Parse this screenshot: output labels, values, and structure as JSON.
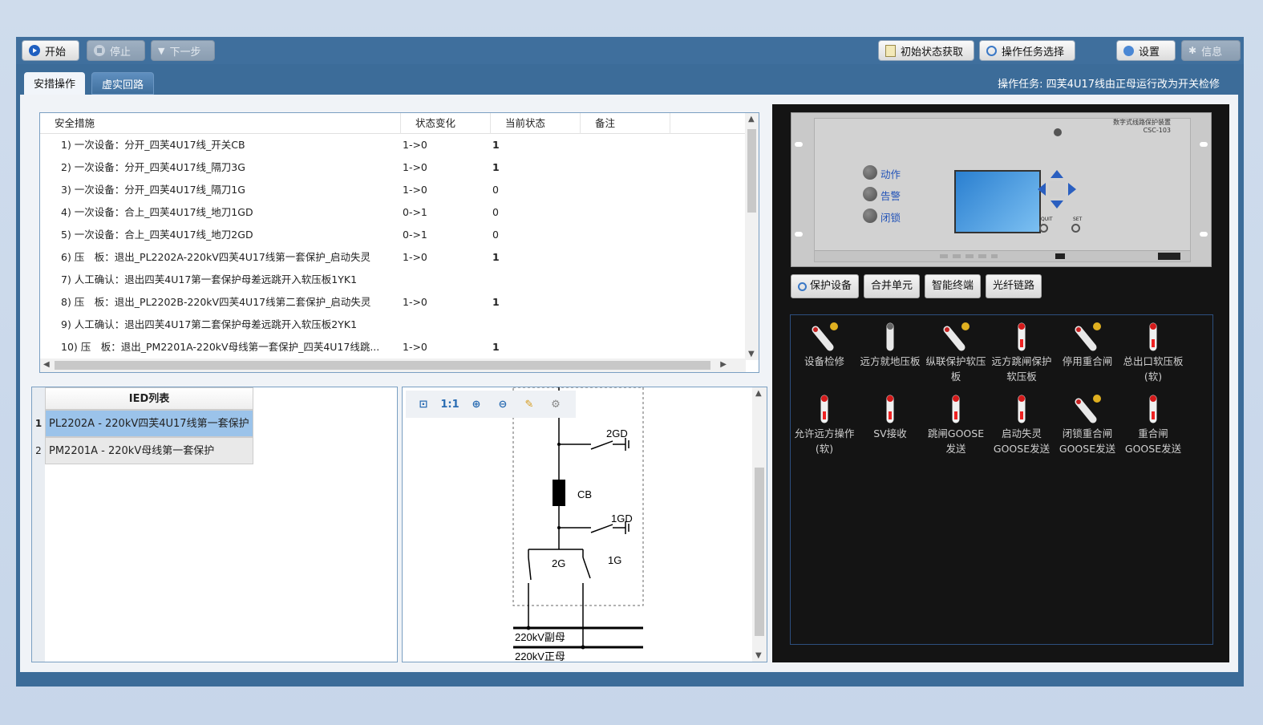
{
  "toolbar": {
    "start_label": "开始",
    "stop_label": "停止",
    "next_label": "下一步",
    "init_state_label": "初始状态获取",
    "task_select_label": "操作任务选择",
    "settings_label": "设置",
    "info_label": "信息"
  },
  "tabs": [
    "安措操作",
    "虚实回路"
  ],
  "task_text": "操作任务: 四芙4U17线由正母运行改为开关检修",
  "steps_table": {
    "headers": [
      "安全措施",
      "状态变化",
      "当前状态",
      "备注"
    ],
    "rows": [
      {
        "measure": "1) 一次设备：分开_四芙4U17线_开关CB",
        "change": "1->0",
        "current": "1"
      },
      {
        "measure": "2) 一次设备：分开_四芙4U17线_隔刀3G",
        "change": "1->0",
        "current": "1"
      },
      {
        "measure": "3) 一次设备：分开_四芙4U17线_隔刀1G",
        "change": "1->0",
        "current": "0"
      },
      {
        "measure": "4) 一次设备：合上_四芙4U17线_地刀1GD",
        "change": "0->1",
        "current": "0"
      },
      {
        "measure": "5) 一次设备：合上_四芙4U17线_地刀2GD",
        "change": "0->1",
        "current": "0"
      },
      {
        "measure": "6) 压　板：退出_PL2202A-220kV四芙4U17线第一套保护_启动失灵",
        "change": "1->0",
        "current": "1"
      },
      {
        "measure": "7) 人工确认：退出四芙4U17第一套保护母差远跳开入软压板1YK1",
        "change": "",
        "current": ""
      },
      {
        "measure": "8) 压　板：退出_PL2202B-220kV四芙4U17线第二套保护_启动失灵",
        "change": "1->0",
        "current": "1"
      },
      {
        "measure": "9) 人工确认：退出四芙4U17第二套保护母差远跳开入软压板2YK1",
        "change": "",
        "current": ""
      },
      {
        "measure": "10) 压　板：退出_PM2201A-220kV母线第一套保护_四芙4U17线跳...",
        "change": "1->0",
        "current": "1"
      }
    ]
  },
  "ied_list": {
    "header": "IED列表",
    "rows": [
      {
        "num": "1",
        "name": "PL2202A - 220kV四芙4U17线第一套保护"
      },
      {
        "num": "2",
        "name": "PM2201A - 220kV母线第一套保护"
      }
    ]
  },
  "diagram": {
    "tools": [
      "zoom-fit-icon",
      "actual-size-icon",
      "zoom-in-icon",
      "zoom-out-icon",
      "brush-icon",
      "gear-icon"
    ],
    "actual_size_label": "1:1",
    "labels": {
      "gd2": "2GD",
      "cb": "CB",
      "gd1": "1GD",
      "g2": "2G",
      "g1": "1G",
      "bus2": "220kV副母",
      "bus1": "220kV正母"
    }
  },
  "relay": {
    "title": "数字式线路保护装置",
    "model": "CSC-103",
    "leds": [
      "动作",
      "告警",
      "闭锁"
    ],
    "quit_label": "QUIT",
    "set_label": "SET"
  },
  "device_tabs": [
    "保护设备",
    "合并单元",
    "智能终端",
    "光纤链路"
  ],
  "plates": [
    {
      "label": "设备检修",
      "state": "tilted"
    },
    {
      "label": "远方就地压板",
      "state": "off-grey"
    },
    {
      "label": "纵联保护软压板",
      "state": "tilted"
    },
    {
      "label": "远方跳闸保护软压板",
      "state": "on-red"
    },
    {
      "label": "停用重合闸",
      "state": "tilted"
    },
    {
      "label": "总出口软压板(软)",
      "state": "on-red"
    },
    {
      "label": "允许远方操作(软)",
      "state": "on-red"
    },
    {
      "label": "SV接收",
      "state": "on-red"
    },
    {
      "label": "跳闸GOOSE发送",
      "state": "on-red"
    },
    {
      "label": "启动失灵GOOSE发送",
      "state": "on-red"
    },
    {
      "label": "闭锁重合闸GOOSE发送",
      "state": "tilted"
    },
    {
      "label": "重合闸GOOSE发送",
      "state": "on-red"
    }
  ]
}
